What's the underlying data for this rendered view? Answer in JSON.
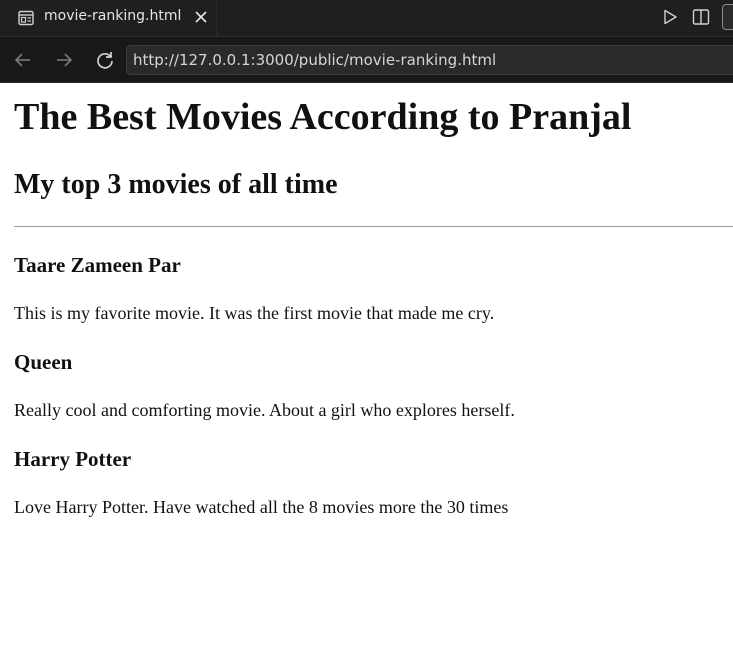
{
  "tab": {
    "title": "movie-ranking.html",
    "close_icon": "close-icon",
    "page_icon": "preview-icon"
  },
  "toolbar": {
    "run_icon": "play-icon",
    "split_icon": "split-editor-icon"
  },
  "navigation": {
    "back_icon": "back-arrow-icon",
    "forward_icon": "forward-arrow-icon",
    "reload_icon": "reload-icon",
    "url": "http://127.0.0.1:3000/public/movie-ranking.html"
  },
  "page": {
    "heading": "The Best Movies According to Pranjal",
    "subheading": "My top 3 movies of all time",
    "movies": [
      {
        "title": "Taare Zameen Par",
        "description": "This is my favorite movie. It was the first movie that made me cry."
      },
      {
        "title": "Queen",
        "description": "Really cool and comforting movie. About a girl who explores herself."
      },
      {
        "title": "Harry Potter",
        "description": "Love Harry Potter. Have watched all the 8 movies more the 30 times"
      }
    ]
  },
  "colors": {
    "chrome_background": "#1f1f1f",
    "address_background": "#2a2a2a",
    "page_background": "#ffffff",
    "text": "#111111"
  }
}
